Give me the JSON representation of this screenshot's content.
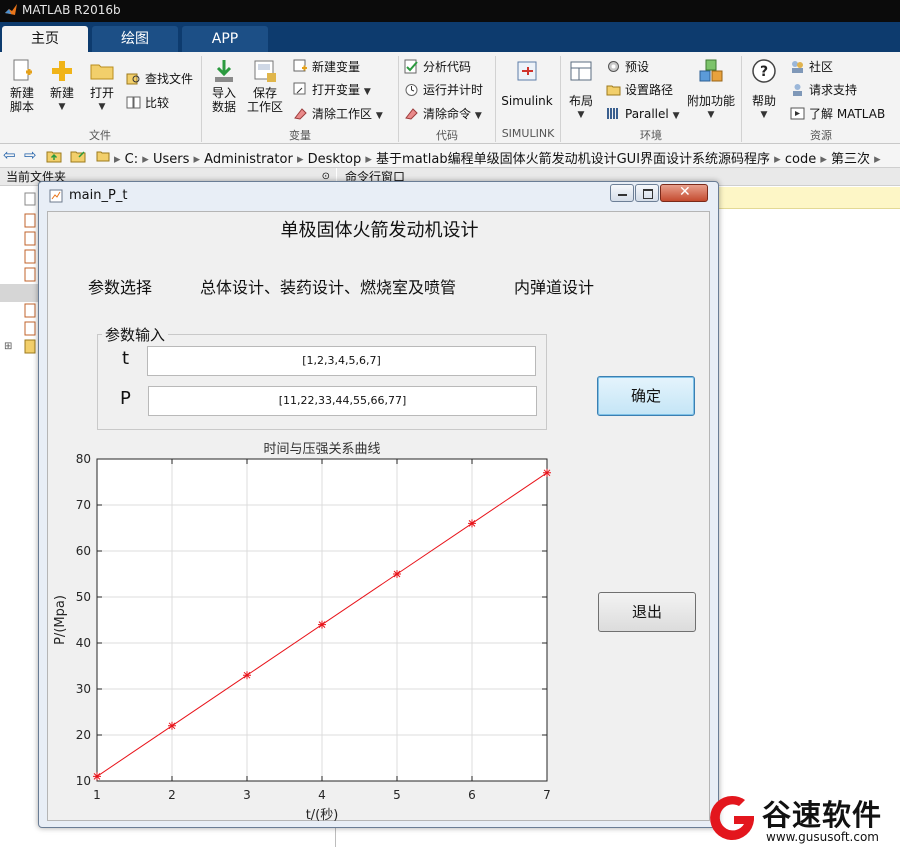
{
  "app": {
    "title": "MATLAB R2016b"
  },
  "tabs": [
    {
      "label": "主页",
      "active": true
    },
    {
      "label": "绘图",
      "active": false
    },
    {
      "label": "APP",
      "active": false
    }
  ],
  "ribbon": {
    "file": {
      "new_script": "新建\n脚本",
      "new": "新建",
      "open": "打开",
      "find_files": "查找文件",
      "compare": "比较",
      "label": "文件"
    },
    "variable": {
      "import": "导入\n数据",
      "save": "保存\n工作区",
      "new_var": "新建变量",
      "open_var": "打开变量",
      "clear_ws": "清除工作区",
      "label": "变量"
    },
    "code": {
      "analyze": "分析代码",
      "run_time": "运行并计时",
      "clear_cmd": "清除命令",
      "label": "代码"
    },
    "simulink": {
      "btn": "Simulink",
      "label": "SIMULINK"
    },
    "env": {
      "layout": "布局",
      "prefs": "预设",
      "set_path": "设置路径",
      "parallel": "Parallel",
      "addons": "附加功能",
      "label": "环境"
    },
    "resources": {
      "help": "帮助",
      "community": "社区",
      "support": "请求支持",
      "learn": "了解 MATLAB",
      "label": "资源"
    }
  },
  "address": {
    "crumbs": [
      "C:",
      "Users",
      "Administrator",
      "Desktop",
      "基于matlab编程单级固体火箭发动机设计GUI界面设计系统源码程序",
      "code",
      "第三次"
    ]
  },
  "panels": {
    "current_folder": "当前文件夹",
    "command_window": "命令行窗口"
  },
  "figure": {
    "window_title": "main_P_t",
    "heading": "单极固体火箭发动机设计",
    "nav": {
      "param": "参数选择",
      "overall": "总体设计、装药设计、燃烧室及喷管",
      "ballistic": "内弹道设计"
    },
    "panel_title": "参数输入",
    "t_label": "t",
    "t_value": "[1,2,3,4,5,6,7]",
    "p_label": "P",
    "p_value": "[11,22,33,44,55,66,77]",
    "ok_button": "确定",
    "exit_button": "退出"
  },
  "chart_data": {
    "type": "line",
    "title": "时间与压强关系曲线",
    "xlabel": "t/(秒)",
    "ylabel": "P/(Mpa)",
    "x": [
      1,
      2,
      3,
      4,
      5,
      6,
      7
    ],
    "series": [
      {
        "values": [
          11,
          22,
          33,
          44,
          55,
          66,
          77
        ],
        "color": "#e8141b",
        "marker": "*"
      }
    ],
    "xlim": [
      1,
      7
    ],
    "ylim": [
      10,
      80
    ],
    "xticks": [
      1,
      2,
      3,
      4,
      5,
      6,
      7
    ],
    "yticks": [
      10,
      20,
      30,
      40,
      50,
      60,
      70,
      80
    ],
    "grid": true
  },
  "watermark": {
    "name": "谷速软件",
    "url": "www.gususoft.com"
  }
}
